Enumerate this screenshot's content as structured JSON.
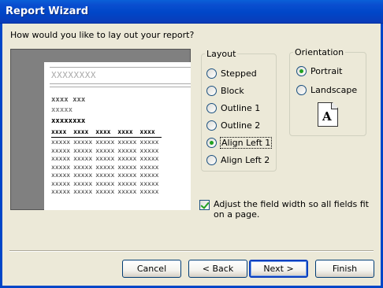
{
  "window": {
    "title": "Report Wizard"
  },
  "question": "How would you like to lay out your report?",
  "preview": {
    "title_placeholder": "XXXXXXXX",
    "group_lines": [
      "xxxx xxx",
      "xxxxx",
      "xxxxxxxx"
    ],
    "table_headers": [
      "xxxx",
      "xxxx",
      "xxxx",
      "xxxx",
      "xxxx"
    ],
    "table_rows": [
      [
        "xxxxx",
        "xxxxx",
        "xxxxx",
        "xxxxx",
        "xxxxx"
      ],
      [
        "xxxxx",
        "xxxxx",
        "xxxxx",
        "xxxxx",
        "xxxxx"
      ],
      [
        "xxxxx",
        "xxxxx",
        "xxxxx",
        "xxxxx",
        "xxxxx"
      ],
      [
        "xxxxx",
        "xxxxx",
        "xxxxx",
        "xxxxx",
        "xxxxx"
      ],
      [
        "xxxxx",
        "xxxxx",
        "xxxxx",
        "xxxxx",
        "xxxxx"
      ],
      [
        "xxxxx",
        "xxxxx",
        "xxxxx",
        "xxxxx",
        "xxxxx"
      ],
      [
        "xxxxx",
        "xxxxx",
        "xxxxx",
        "xxxxx",
        "xxxxx"
      ]
    ]
  },
  "layout": {
    "legend": "Layout",
    "options": [
      "Stepped",
      "Block",
      "Outline 1",
      "Outline 2",
      "Align Left 1",
      "Align Left 2"
    ],
    "selected": "Align Left 1"
  },
  "orientation": {
    "legend": "Orientation",
    "options": [
      "Portrait",
      "Landscape"
    ],
    "selected": "Portrait",
    "icon_letter": "A"
  },
  "adjust_width": {
    "label": "Adjust the field width so all fields fit on a page.",
    "checked": true
  },
  "buttons": {
    "cancel": "Cancel",
    "back": "< Back",
    "next": "Next >",
    "finish": "Finish"
  },
  "colors": {
    "title_bar": "#0046c8",
    "dialog_bg": "#ece9d8",
    "preview_bg": "#808080",
    "radio_dot": "#21a121"
  }
}
